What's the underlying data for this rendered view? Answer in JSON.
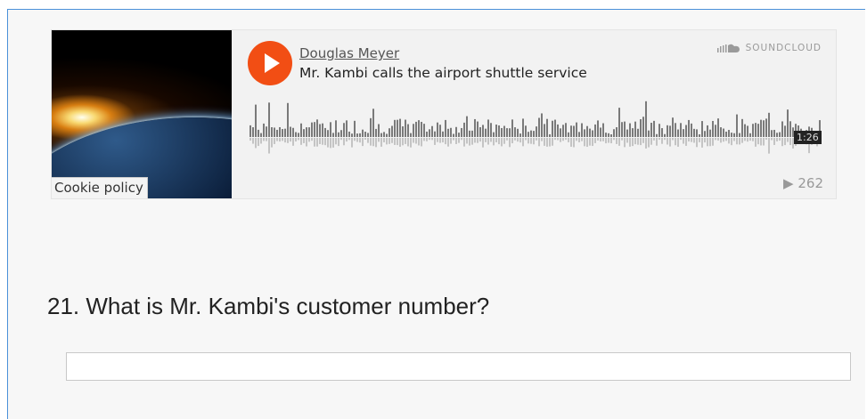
{
  "player": {
    "artist": "Douglas Meyer",
    "track_title": "Mr. Kambi calls the airport shuttle service",
    "brand": "SOUNDCLOUD",
    "duration": "1:26",
    "plays": "262",
    "play_icon": "play-icon",
    "cookie_label": "Cookie policy",
    "accent_color": "#f24e14"
  },
  "question": {
    "text": "21. What is Mr. Kambi's customer number?",
    "answer_value": ""
  }
}
